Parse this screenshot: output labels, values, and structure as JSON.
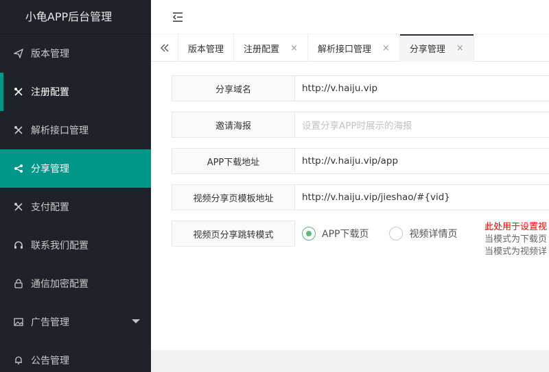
{
  "app": {
    "title": "小龟APP后台管理"
  },
  "sidebar": {
    "items": [
      {
        "label": "版本管理",
        "icon": "paper-plane-icon"
      },
      {
        "label": "注册配置",
        "icon": "tools-icon"
      },
      {
        "label": "解析接口管理",
        "icon": "tools-icon"
      },
      {
        "label": "分享管理",
        "icon": "share-icon"
      },
      {
        "label": "支付配置",
        "icon": "tools-icon"
      },
      {
        "label": "联系我们配置",
        "icon": "headset-icon"
      },
      {
        "label": "通信加密配置",
        "icon": "lock-icon"
      },
      {
        "label": "广告管理",
        "icon": "image-icon"
      },
      {
        "label": "公告管理",
        "icon": "bell-icon"
      }
    ]
  },
  "tabs": {
    "items": [
      {
        "label": "版本管理"
      },
      {
        "label": "注册配置",
        "close": "×"
      },
      {
        "label": "解析接口管理",
        "close": "×"
      },
      {
        "label": "分享管理",
        "close": "×"
      }
    ]
  },
  "form": {
    "share_domain": {
      "label": "分享域名",
      "value": "http://v.haiju.vip"
    },
    "invite_poster": {
      "label": "邀请海报",
      "placeholder": "设置分享APP时展示的海报"
    },
    "app_download": {
      "label": "APP下载地址",
      "value": "http://v.haiju.vip/app"
    },
    "video_share_template": {
      "label": "视频分享页模板地址",
      "value": "http://v.haiju.vip/jieshao/#{vid}"
    },
    "jump_mode": {
      "label": "视频页分享跳转模式",
      "options": [
        "APP下载页",
        "视频详情页"
      ],
      "selected": "APP下载页"
    },
    "hint": {
      "line1": "此处用于设置视",
      "line2": "当模式为下载页",
      "line3": "当模式为视频详"
    }
  },
  "colors": {
    "accent": "#009688",
    "radio": "#5fb878",
    "hint_red": "#ff0000"
  }
}
